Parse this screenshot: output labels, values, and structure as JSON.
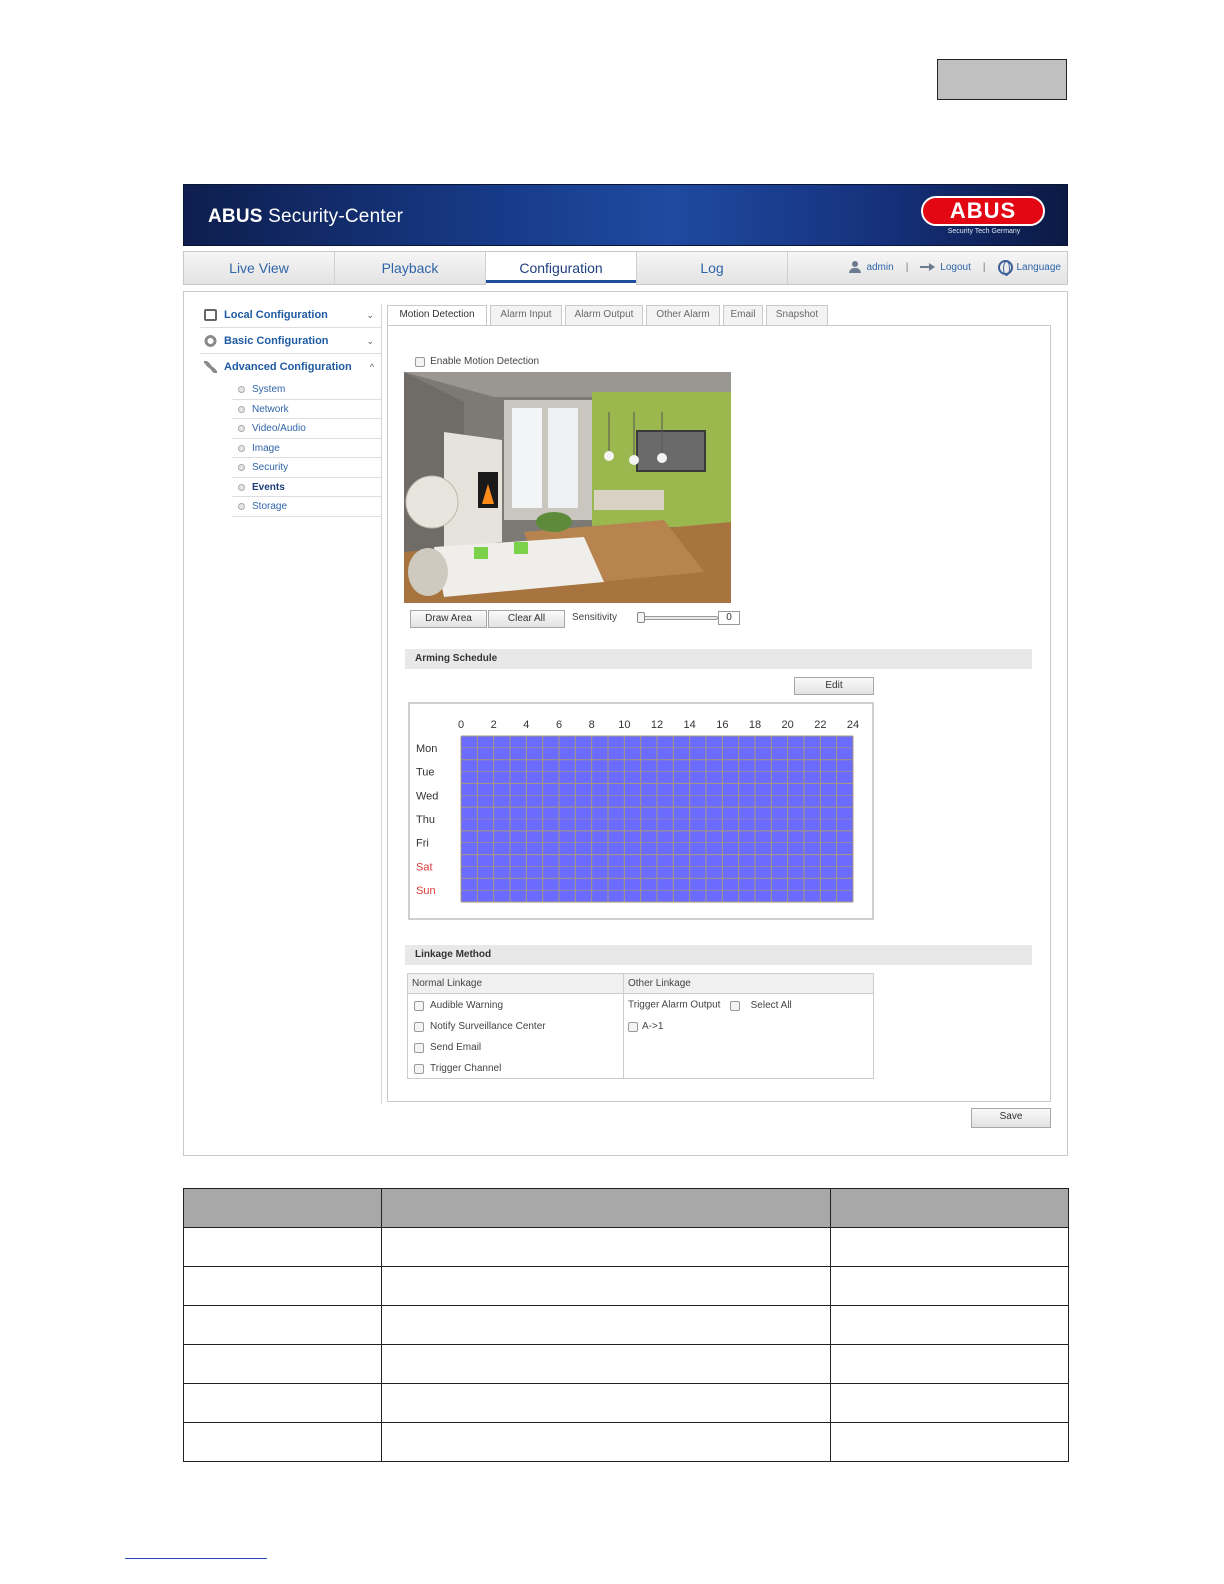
{
  "banner": {
    "title_bold": "ABUS",
    "title_rest": " Security-Center",
    "logo_text": "ABUS",
    "logo_tagline": "Security Tech Germany"
  },
  "nav": {
    "tabs": [
      {
        "label": "Live View"
      },
      {
        "label": "Playback"
      },
      {
        "label": "Configuration",
        "active": true
      },
      {
        "label": "Log"
      }
    ],
    "user": "admin",
    "logout": "Logout",
    "language": "Language",
    "separator": "|"
  },
  "sidebar": {
    "local": "Local Configuration",
    "basic": "Basic Configuration",
    "advanced": "Advanced Configuration",
    "chevron_down": "⌄",
    "chevron_up": "^",
    "sub_items": [
      {
        "label": "System"
      },
      {
        "label": "Network"
      },
      {
        "label": "Video/Audio"
      },
      {
        "label": "Image"
      },
      {
        "label": "Security"
      },
      {
        "label": "Events",
        "active": true
      },
      {
        "label": "Storage"
      }
    ]
  },
  "tabs": [
    {
      "label": "Motion Detection",
      "active": true
    },
    {
      "label": "Alarm Input"
    },
    {
      "label": "Alarm Output"
    },
    {
      "label": "Other Alarm"
    },
    {
      "label": "Email"
    },
    {
      "label": "Snapshot"
    }
  ],
  "motion": {
    "enable_label": "Enable Motion Detection",
    "draw_area": "Draw Area",
    "clear_all": "Clear All",
    "sensitivity_label": "Sensitivity",
    "sensitivity_value": "0"
  },
  "schedule": {
    "title": "Arming Schedule",
    "edit": "Edit",
    "hours": [
      "0",
      "2",
      "4",
      "6",
      "8",
      "10",
      "12",
      "14",
      "16",
      "18",
      "20",
      "22",
      "24"
    ],
    "days": [
      {
        "label": "Mon",
        "weekend": false
      },
      {
        "label": "Tue",
        "weekend": false
      },
      {
        "label": "Wed",
        "weekend": false
      },
      {
        "label": "Thu",
        "weekend": false
      },
      {
        "label": "Fri",
        "weekend": false
      },
      {
        "label": "Sat",
        "weekend": true
      },
      {
        "label": "Sun",
        "weekend": true
      }
    ],
    "fill_color": "#6b6bff",
    "grid_color": "#a89a7a",
    "weekend_color": "#e03a3a",
    "armed_all_day": true
  },
  "linkage": {
    "title": "Linkage Method",
    "normal_header": "Normal Linkage",
    "other_header": "Other Linkage",
    "normal_items": [
      "Audible Warning",
      "Notify Surveillance Center",
      "Send Email",
      "Trigger Channel"
    ],
    "trigger_alarm_output": "Trigger Alarm Output",
    "select_all": "Select All",
    "output_item": "A->1"
  },
  "save": "Save"
}
